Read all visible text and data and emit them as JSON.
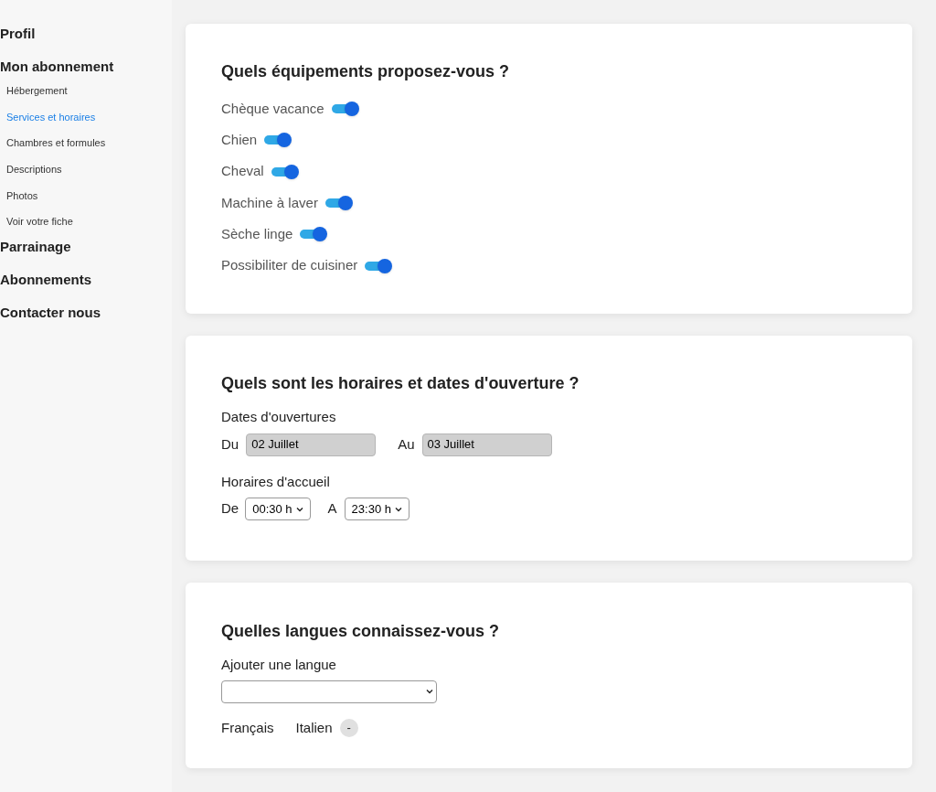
{
  "sidebar": {
    "items": [
      {
        "label": "Profil",
        "selected": false
      },
      {
        "label": "Mon abonnement",
        "selected": false,
        "children": [
          {
            "label": "Hébergement",
            "selected": false
          },
          {
            "label": "Services et horaires",
            "selected": true
          },
          {
            "label": "Chambres et formules",
            "selected": false
          },
          {
            "label": "Descriptions",
            "selected": false
          },
          {
            "label": "Photos",
            "selected": false
          },
          {
            "label": "Voir votre fiche",
            "selected": false
          }
        ]
      },
      {
        "label": "Parrainage",
        "selected": false
      },
      {
        "label": "Abonnements",
        "selected": false
      },
      {
        "label": "Contacter nous",
        "selected": false
      }
    ]
  },
  "equipment": {
    "title": "Quels équipements proposez-vous ?",
    "items": [
      {
        "label": "Chèque vacance",
        "on": true
      },
      {
        "label": "Chien",
        "on": true
      },
      {
        "label": "Cheval",
        "on": true
      },
      {
        "label": "Machine à laver",
        "on": true
      },
      {
        "label": "Sèche linge",
        "on": true
      },
      {
        "label": "Possibiliter de cuisiner",
        "on": true
      }
    ]
  },
  "hours": {
    "title": "Quels sont les horaires et dates d'ouverture ?",
    "dates_label": "Dates d'ouvertures",
    "from_label": "Du",
    "from_value": "02 Juillet",
    "to_label": "Au",
    "to_value": "03 Juillet",
    "hours_label": "Horaires d'accueil",
    "open_label": "De",
    "open_value": "00:30 h",
    "close_label": "A",
    "close_value": "23:30 h"
  },
  "languages": {
    "title": "Quelles langues connaissez-vous ?",
    "add_label": "Ajouter une langue",
    "items": [
      {
        "name": "Français"
      },
      {
        "name": "Italien",
        "remove": "-"
      }
    ]
  }
}
